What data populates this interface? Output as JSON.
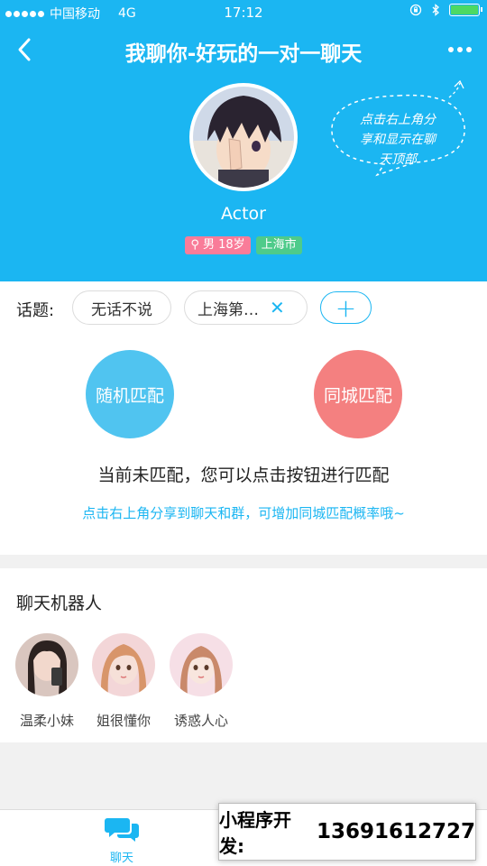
{
  "status_bar": {
    "carrier": "中国移动",
    "network": "4G",
    "time": "17:12"
  },
  "nav": {
    "title": "我聊你-好玩的一对一聊天"
  },
  "profile": {
    "name": "Actor",
    "gender_age": "男 18岁",
    "city": "上海市",
    "gender_color": "#f97c99",
    "city_color": "#4ecb8a"
  },
  "hint_bubble": {
    "line1": "点击右上角分",
    "line2": "享和显示在聊",
    "line3": "天顶部"
  },
  "topics": {
    "label": "话题:",
    "chips": [
      "无话不说",
      "上海第…"
    ],
    "add_label": "+"
  },
  "match": {
    "random_label": "随机匹配",
    "city_label": "同城匹配",
    "status": "当前未匹配，您可以点击按钮进行匹配",
    "tip": "点击右上角分享到聊天和群，可增加同城匹配概率哦~"
  },
  "robots": {
    "title": "聊天机器人",
    "items": [
      {
        "name": "温柔小妹"
      },
      {
        "name": "姐很懂你"
      },
      {
        "name": "诱惑人心"
      }
    ]
  },
  "tabbar": {
    "chat_label": "聊天"
  },
  "ad": {
    "label": "小程序开发:",
    "phone": "13691612727"
  },
  "colors": {
    "primary": "#1bb6f2",
    "random": "#50c4f0",
    "city": "#f48080"
  }
}
